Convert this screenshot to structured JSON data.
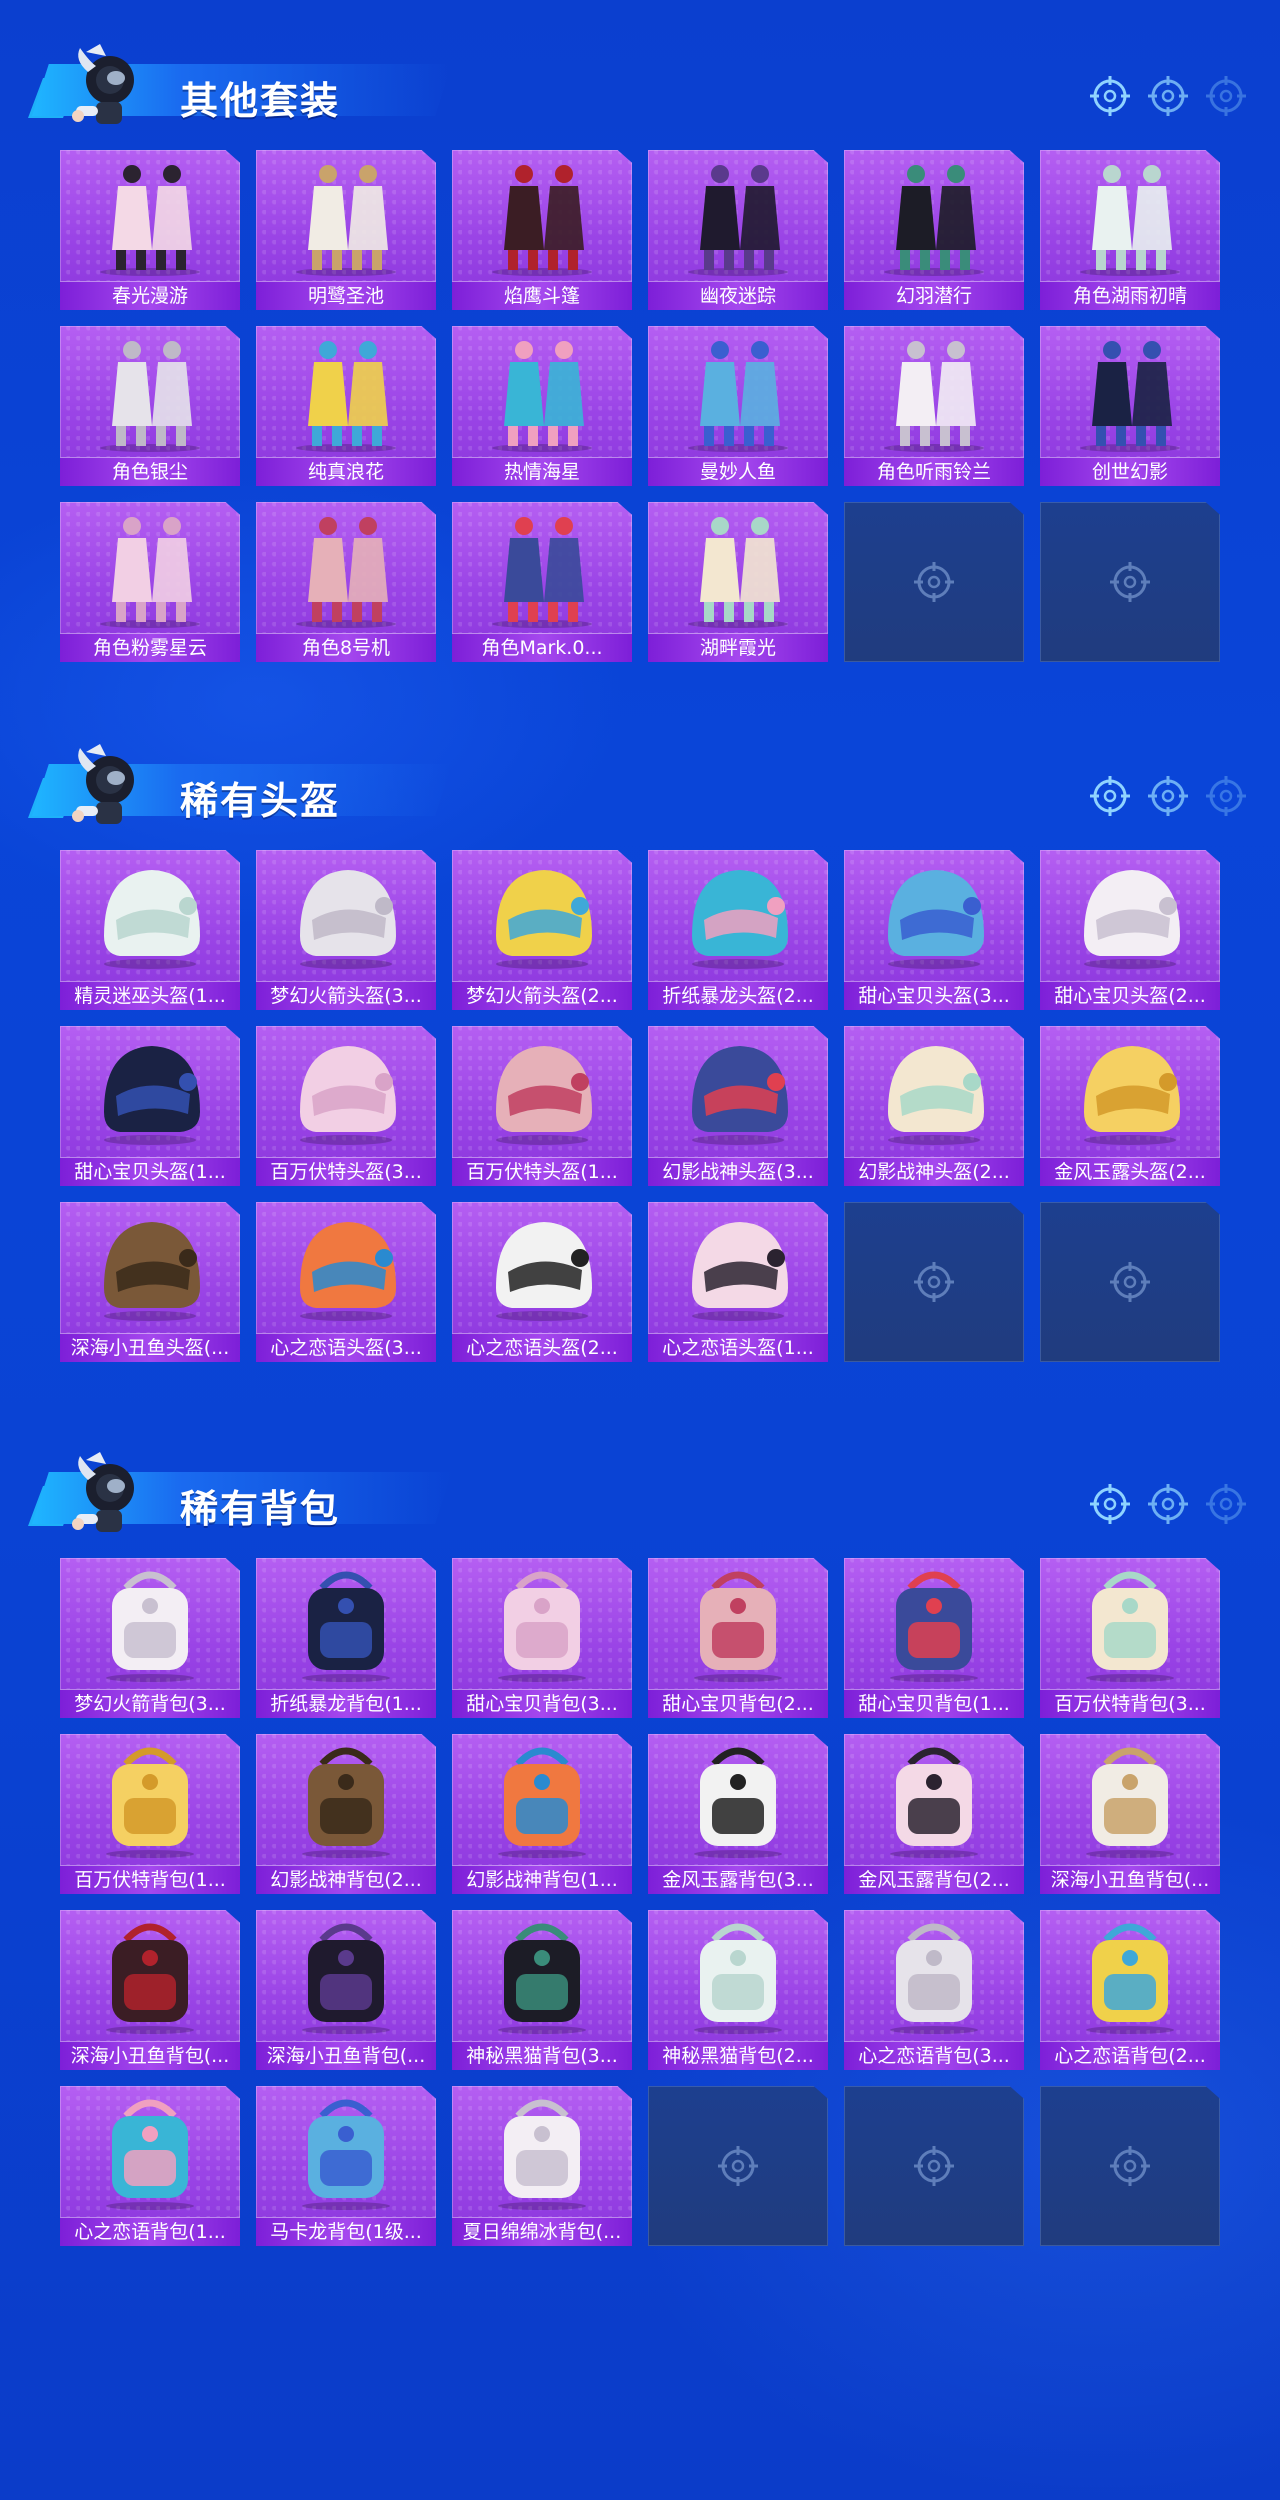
{
  "sections": [
    {
      "title": "其他套装",
      "items": [
        "春光漫游",
        "明鹭圣池",
        "焰鹰斗篷",
        "幽夜迷踪",
        "幻羽潜行",
        "角色湖雨初晴",
        "角色银尘",
        "纯真浪花",
        "热情海星",
        "曼妙人鱼",
        "角色听雨铃兰",
        "创世幻影",
        "角色粉雾星云",
        "角色8号机",
        "角色Mark.0...",
        "湖畔霞光"
      ],
      "empty_slots": 2
    },
    {
      "title": "稀有头盔",
      "items": [
        "精灵迷巫头盔(1...",
        "梦幻火箭头盔(3...",
        "梦幻火箭头盔(2...",
        "折纸暴龙头盔(2...",
        "甜心宝贝头盔(3...",
        "甜心宝贝头盔(2...",
        "甜心宝贝头盔(1...",
        "百万伏特头盔(3...",
        "百万伏特头盔(1...",
        "幻影战神头盔(3...",
        "幻影战神头盔(2...",
        "金风玉露头盔(2...",
        "深海小丑鱼头盔(...",
        "心之恋语头盔(3...",
        "心之恋语头盔(2...",
        "心之恋语头盔(1..."
      ],
      "empty_slots": 2
    },
    {
      "title": "稀有背包",
      "items": [
        "梦幻火箭背包(3...",
        "折纸暴龙背包(1...",
        "甜心宝贝背包(3...",
        "甜心宝贝背包(2...",
        "甜心宝贝背包(1...",
        "百万伏特背包(3...",
        "百万伏特背包(1...",
        "幻影战神背包(2...",
        "幻影战神背包(1...",
        "金风玉露背包(3...",
        "金风玉露背包(2...",
        "深海小丑鱼背包(...",
        "深海小丑鱼背包(...",
        "深海小丑鱼背包(...",
        "神秘黑猫背包(3...",
        "神秘黑猫背包(2...",
        "心之恋语背包(3...",
        "心之恋语背包(2...",
        "心之恋语背包(1...",
        "马卡龙背包(1级...",
        "夏日绵绵冰背包(..."
      ],
      "empty_slots": 3
    }
  ],
  "icons": {
    "header": "crosshair-icon",
    "empty_slot": "crosshair-icon",
    "mascot": "mascot-icon"
  },
  "colors": {
    "card_purple": "#9a44e6",
    "label_purple": "#7d1fd8",
    "empty_slot": "#1d3f8f",
    "background": "#0a45d8"
  }
}
